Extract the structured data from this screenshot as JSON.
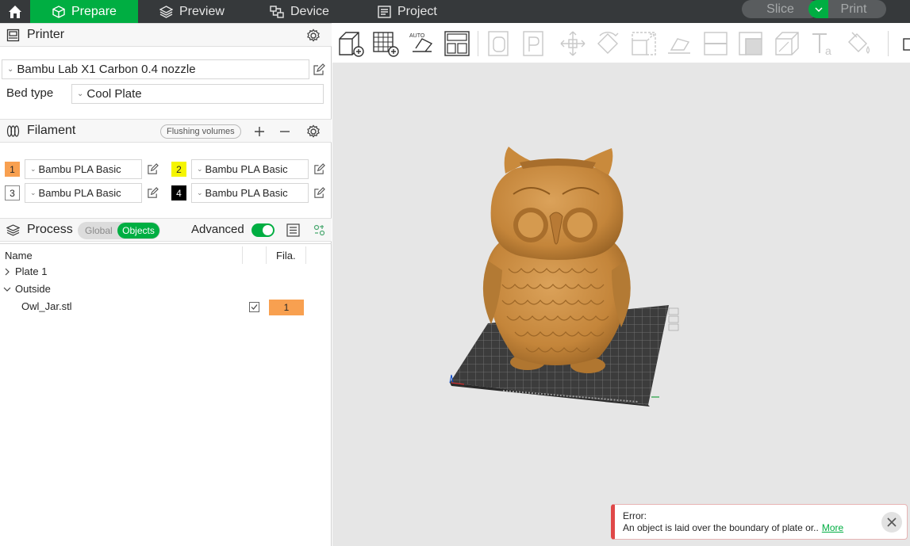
{
  "topbar": {
    "tabs": [
      {
        "label": "Prepare",
        "icon": "cube-icon",
        "active": true
      },
      {
        "label": "Preview",
        "icon": "layers-icon",
        "active": false
      },
      {
        "label": "Device",
        "icon": "device-icon",
        "active": false
      },
      {
        "label": "Project",
        "icon": "project-icon",
        "active": false
      }
    ],
    "slice_label": "Slice",
    "print_label": "Print"
  },
  "printer": {
    "title": "Printer",
    "selected": "Bambu Lab X1 Carbon 0.4 nozzle",
    "bed_type_label": "Bed type",
    "bed_type": "Cool Plate"
  },
  "filament": {
    "title": "Filament",
    "flushing_label": "Flushing volumes",
    "slots": [
      {
        "num": "1",
        "name": "Bambu PLA Basic",
        "color": "#f8a050",
        "text_color": "#262626"
      },
      {
        "num": "2",
        "name": "Bambu PLA Basic",
        "color": "#f5f500",
        "text_color": "#262626"
      },
      {
        "num": "3",
        "name": "Bambu PLA Basic",
        "color": "#ffffff",
        "text_color": "#262626"
      },
      {
        "num": "4",
        "name": "Bambu PLA Basic",
        "color": "#000000",
        "text_color": "#ffffff"
      }
    ]
  },
  "process": {
    "title": "Process",
    "global_label": "Global",
    "objects_label": "Objects",
    "advanced_label": "Advanced"
  },
  "object_list": {
    "col_name": "Name",
    "col_fila": "Fila.",
    "plate": "Plate 1",
    "group": "Outside",
    "object": "Owl_Jar.stl",
    "object_fila": "1"
  },
  "error": {
    "title": "Error:",
    "message": "An object is laid over the boundary of plate or..",
    "more_label": "More"
  },
  "colors": {
    "accent": "#00ae42",
    "topbar": "#36393b",
    "model": "#c98a3c",
    "error": "#e04848"
  }
}
